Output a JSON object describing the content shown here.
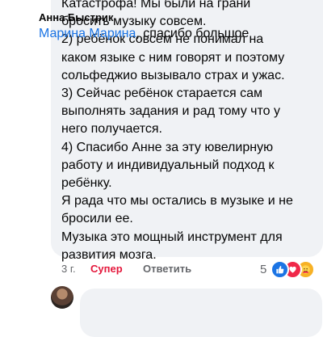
{
  "comment": {
    "text": "Катастрофа! Мы были на грани\nбросить музыку совсем.\n2) ребёнок совсем не понимал на\nкаком языке с ним говорят и поэтому\nсольфеджио вызывало страх и ужас.\n3) Сейчас ребёнок старается сам\nвыполнять задания и рад тому что у\nнего получается.\n4) Спасибо Анне за эту ювелирную\nработу и индивидуальный подход к\nребёнку.\nЯ рада что мы остались в музыке и не\nбросили ее.\nМузыка это мощный инструмент для\nразвития мозга.",
    "time": "3 г.",
    "like_label": "Супер",
    "reply_label": "Ответить",
    "reaction_count": "5",
    "reactions": [
      "like-icon",
      "love-icon",
      "care-icon"
    ],
    "like_color": "#e4173b"
  },
  "reply": {
    "author": "Анна Быстрик",
    "mention": "Марина Марина",
    "text": ", спасибо большое"
  }
}
